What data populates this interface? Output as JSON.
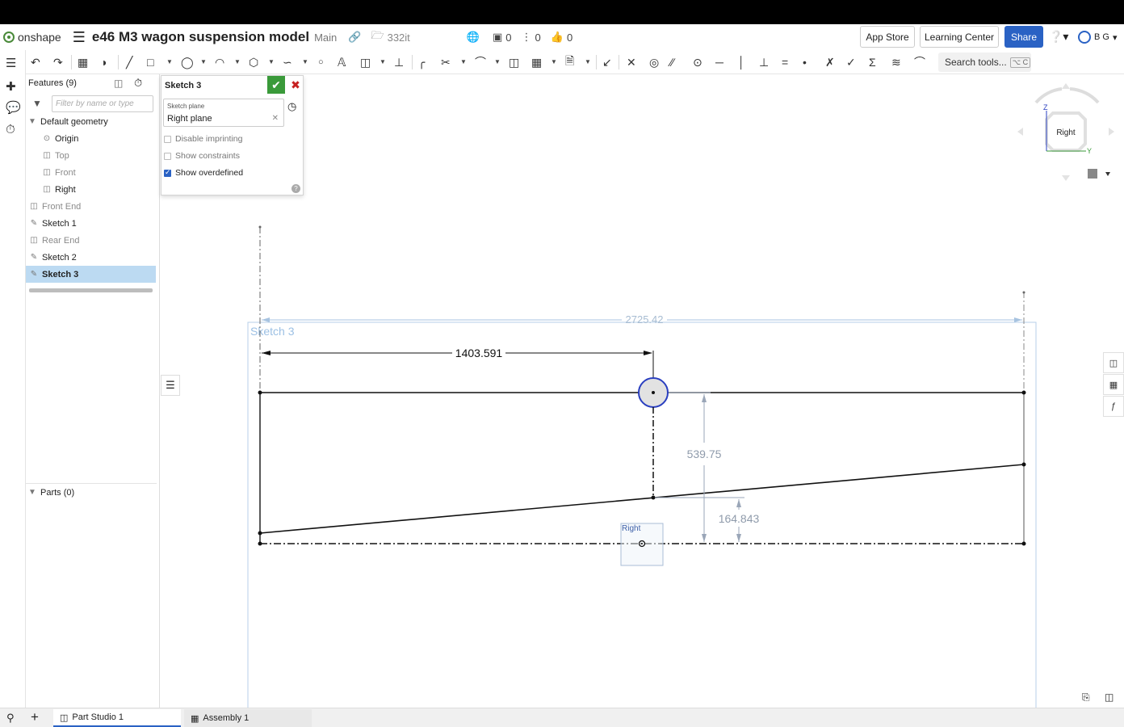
{
  "app": {
    "brand": "onshape",
    "document_title": "e46 M3 wagon suspension model",
    "branch": "Main",
    "workspace": "332it",
    "versions_count": "0",
    "branches_count": "0",
    "likes_count": "0",
    "app_store_label": "App Store",
    "learning_center_label": "Learning Center",
    "share_label": "Share",
    "user_initials": "B G",
    "accent_color": "#2a62c4"
  },
  "toolbar": {
    "search_label": "Search tools...",
    "search_shortcut": "⌥ C"
  },
  "features": {
    "header": "Features (9)",
    "filter_placeholder": "Filter by name or type",
    "default_geometry_label": "Default geometry",
    "items": [
      {
        "label": "Origin"
      },
      {
        "label": "Top"
      },
      {
        "label": "Front"
      },
      {
        "label": "Right"
      },
      {
        "label": "Front End"
      },
      {
        "label": "Sketch 1"
      },
      {
        "label": "Rear End"
      },
      {
        "label": "Sketch 2"
      },
      {
        "label": "Sketch 3"
      }
    ],
    "parts_label": "Parts (0)"
  },
  "sketch_dialog": {
    "title": "Sketch 3",
    "plane_caption": "Sketch plane",
    "plane_value": "Right plane",
    "disable_imprinting": "Disable imprinting",
    "show_constraints": "Show constraints",
    "show_overdefined": "Show overdefined"
  },
  "viewport": {
    "sketch_name": "Sketch 3",
    "plane_label": "Right",
    "viewcube_face": "Right",
    "axis_z": "Z",
    "axis_y": "Y",
    "dimensions": {
      "overall": "2725.42",
      "horizontal": "1403.591",
      "vertical_a": "539.75",
      "vertical_b": "164.843"
    }
  },
  "tabs": [
    {
      "label": "Part Studio 1"
    },
    {
      "label": "Assembly 1"
    }
  ]
}
